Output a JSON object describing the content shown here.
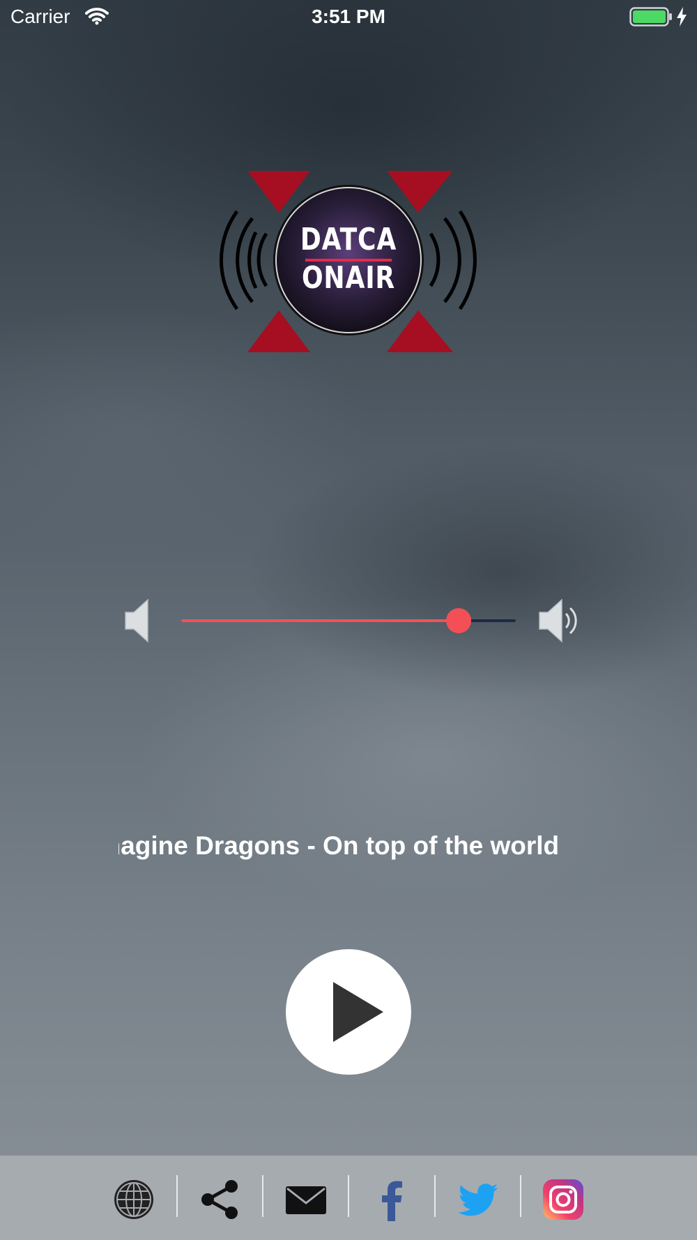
{
  "status_bar": {
    "carrier": "Carrier",
    "time": "3:51 PM"
  },
  "logo": {
    "line1": "DATCA",
    "line2": "ONAIR"
  },
  "volume": {
    "level": 0.83
  },
  "now_playing": {
    "text": "Imagine Dragons - On top of the world"
  },
  "player": {
    "state_icon": "play-icon"
  },
  "footer_icons": [
    "globe-icon",
    "share-icon",
    "mail-icon",
    "facebook-icon",
    "twitter-icon",
    "instagram-icon"
  ],
  "colors": {
    "accent": "#f44f57",
    "track": "#1d2a44",
    "logo_red": "#a50f21",
    "facebook": "#3b5998",
    "twitter": "#1da1f2",
    "battery": "#4cd964"
  }
}
